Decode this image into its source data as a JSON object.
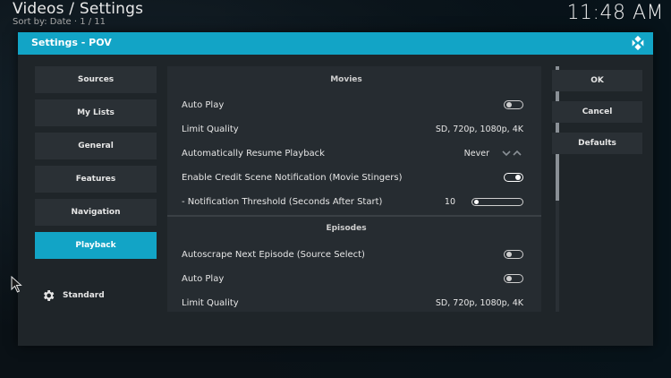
{
  "header": {
    "title": "Videos / Settings",
    "subtitle": "Sort by: Date  ·  1 / 11",
    "clock": "11:48 AM"
  },
  "dialog": {
    "title": "Settings - POV",
    "categories": [
      {
        "label": "Sources",
        "active": false
      },
      {
        "label": "My Lists",
        "active": false
      },
      {
        "label": "General",
        "active": false
      },
      {
        "label": "Features",
        "active": false
      },
      {
        "label": "Navigation",
        "active": false
      },
      {
        "label": "Playback",
        "active": true
      }
    ],
    "settings_level": "Standard",
    "groups": {
      "movies": {
        "title": "Movies",
        "items": [
          {
            "label": "Auto Play",
            "type": "toggle",
            "state": "off"
          },
          {
            "label": "Limit Quality",
            "type": "text",
            "value": "SD, 720p, 1080p, 4K"
          },
          {
            "label": "Automatically Resume Playback",
            "type": "spinner",
            "value": "Never"
          },
          {
            "label": "Enable Credit Scene Notification (Movie Stingers)",
            "type": "toggle",
            "state": "on"
          },
          {
            "label": "- Notification Threshold (Seconds After Start)",
            "type": "slider",
            "value": "10"
          }
        ]
      },
      "episodes": {
        "title": "Episodes",
        "items": [
          {
            "label": "Autoscrape Next Episode (Source Select)",
            "type": "toggle",
            "state": "off"
          },
          {
            "label": "Auto Play",
            "type": "toggle",
            "state": "off"
          },
          {
            "label": "Limit Quality",
            "type": "text",
            "value": "SD, 720p, 1080p, 4K"
          }
        ]
      }
    },
    "actions": {
      "ok": "OK",
      "cancel": "Cancel",
      "defaults": "Defaults"
    }
  },
  "colors": {
    "accent": "#12a4c6",
    "dialog_bg": "#1f2529",
    "button_bg": "#2a3035",
    "panel_bg": "#262c31"
  },
  "icons": {
    "logo": "kodi-logo-icon",
    "level": "gear-icon",
    "spinner": "chevron-up-down-icon",
    "pointer": "mouse-pointer-icon"
  }
}
